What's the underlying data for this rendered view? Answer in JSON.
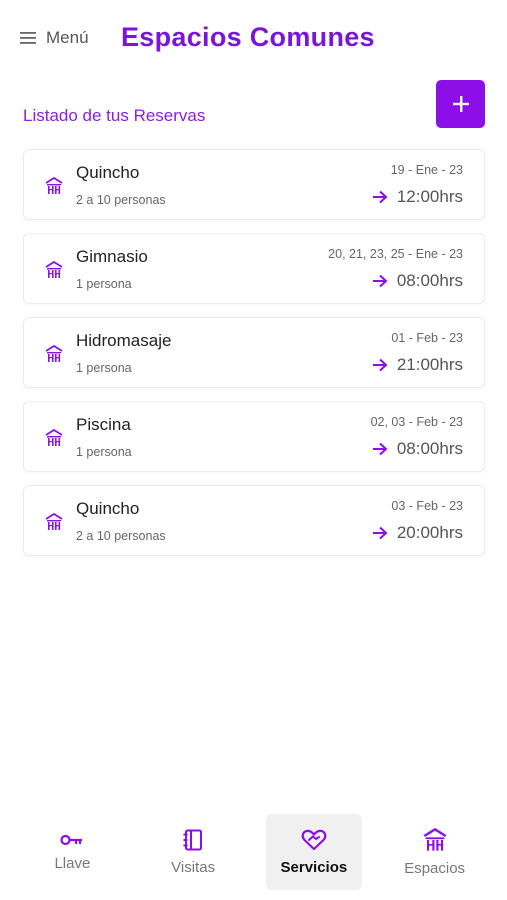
{
  "header": {
    "menu_label": "Menú",
    "title": "Espacios Comunes"
  },
  "section": {
    "title": "Listado de tus Reservas",
    "add_icon": "plus-icon"
  },
  "reservations": [
    {
      "name": "Quincho",
      "capacity": "2 a 10 personas",
      "date": "19 - Ene - 23",
      "time": "12:00hrs"
    },
    {
      "name": "Gimnasio",
      "capacity": "1 persona",
      "date": "20, 21, 23, 25 - Ene - 23",
      "time": "08:00hrs"
    },
    {
      "name": "Hidromasaje",
      "capacity": "1 persona",
      "date": "01 - Feb - 23",
      "time": "21:00hrs"
    },
    {
      "name": "Piscina",
      "capacity": "1 persona",
      "date": "02, 03 - Feb - 23",
      "time": "08:00hrs"
    },
    {
      "name": "Quincho",
      "capacity": "2 a 10 personas",
      "date": "03 - Feb - 23",
      "time": "20:00hrs"
    }
  ],
  "bottom_nav": [
    {
      "label": "Llave",
      "icon": "key-icon",
      "active": false
    },
    {
      "label": "Visitas",
      "icon": "notebook-icon",
      "active": false
    },
    {
      "label": "Servicios",
      "icon": "heart-handshake-icon",
      "active": true
    },
    {
      "label": "Espacios",
      "icon": "building-icon",
      "active": false
    }
  ],
  "colors": {
    "brand": "#7a16d8",
    "accent": "#8c0fe8",
    "text": "#222222",
    "muted": "#666666"
  }
}
